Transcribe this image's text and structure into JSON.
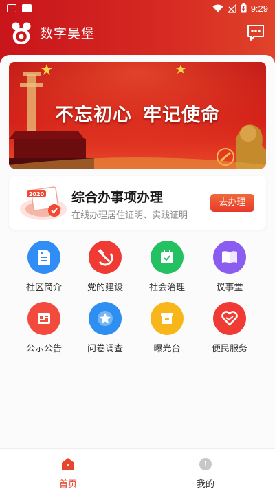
{
  "status_bar": {
    "time": "9:29"
  },
  "app": {
    "title": "数字吴堡"
  },
  "banner": {
    "text_left": "不忘初心",
    "text_right": "牢记使命"
  },
  "service_card": {
    "year_badge": "2020",
    "title": "综合办事项办理",
    "subtitle": "在线办理居住证明、实践证明",
    "button": "去办理"
  },
  "grid": [
    {
      "label": "社区简介",
      "icon": "document-icon",
      "color": "#2f8df5"
    },
    {
      "label": "党的建设",
      "icon": "hammer-sickle-icon",
      "color": "#ef3b34"
    },
    {
      "label": "社会治理",
      "icon": "calendar-check-icon",
      "color": "#23c162"
    },
    {
      "label": "议事堂",
      "icon": "book-icon",
      "color": "#8a5cf0"
    },
    {
      "label": "公示公告",
      "icon": "announcement-icon",
      "color": "#f24a3d"
    },
    {
      "label": "问卷调查",
      "icon": "star-icon",
      "color": "#2e8ff0"
    },
    {
      "label": "曝光台",
      "icon": "box-icon",
      "color": "#f7b71a"
    },
    {
      "label": "便民服务",
      "icon": "heart-icon",
      "color": "#ef3b34"
    }
  ],
  "tabbar": {
    "home": {
      "label": "首页",
      "active": true
    },
    "mine": {
      "label": "我的",
      "active": false
    }
  },
  "colors": {
    "primary": "#d21f1b",
    "tab_active": "#e8452e",
    "tab_inactive": "#333333"
  }
}
